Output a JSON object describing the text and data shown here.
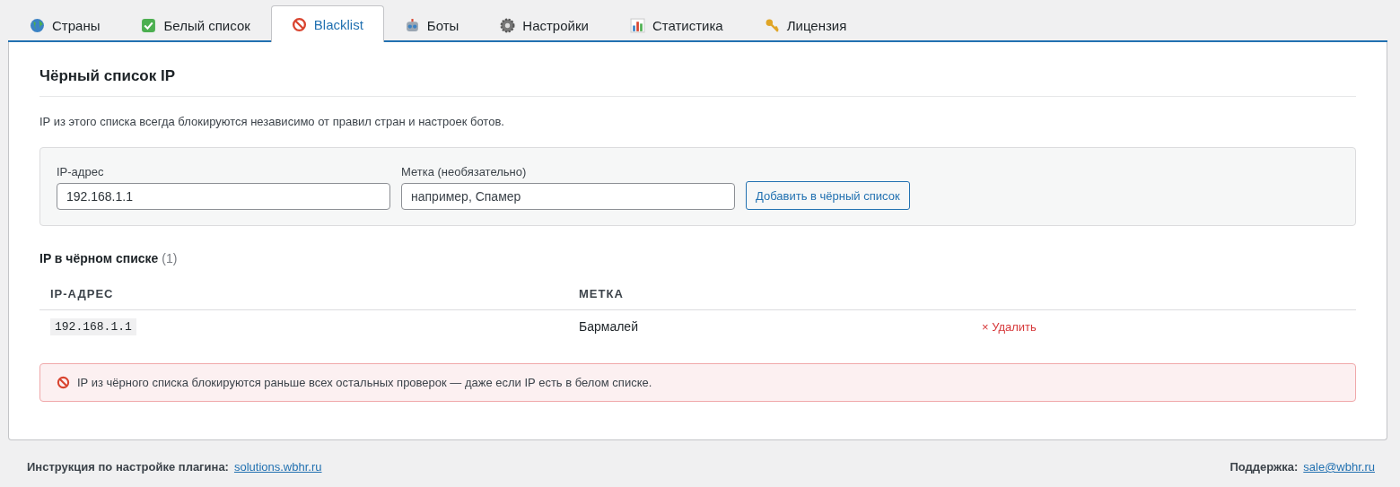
{
  "tabs": [
    {
      "label": "Страны",
      "selected": false
    },
    {
      "label": "Белый список",
      "selected": false
    },
    {
      "label": "Blacklist",
      "selected": true
    },
    {
      "label": "Боты",
      "selected": false
    },
    {
      "label": "Настройки",
      "selected": false
    },
    {
      "label": "Статистика",
      "selected": false
    },
    {
      "label": "Лицензия",
      "selected": false
    }
  ],
  "panel": {
    "title": "Чёрный список IP",
    "description": "IP из этого списка всегда блокируются независимо от правил стран и настроек ботов.",
    "form": {
      "ip_label": "IP-адрес",
      "ip_value": "192.168.1.1",
      "note_label": "Метка (необязательно)",
      "note_placeholder": "например, Спамер",
      "button": "Добавить в чёрный список"
    },
    "list_title": "IP в чёрном списке",
    "list_count": "(1)",
    "table": {
      "columns": [
        "IP-АДРЕС",
        "МЕТКА"
      ],
      "rows": [
        {
          "ip": "192.168.1.1",
          "note": "Бармалей",
          "action": "× Удалить"
        }
      ]
    },
    "notice": "IP из чёрного списка блокируются раньше всех остальных проверок — даже если IP есть в белом списке."
  },
  "footer": {
    "left_label": "Инструкция по настройке плагина:",
    "left_link": "solutions.wbhr.ru",
    "right_label": "Поддержка:",
    "right_link": "sale@wbhr.ru"
  }
}
